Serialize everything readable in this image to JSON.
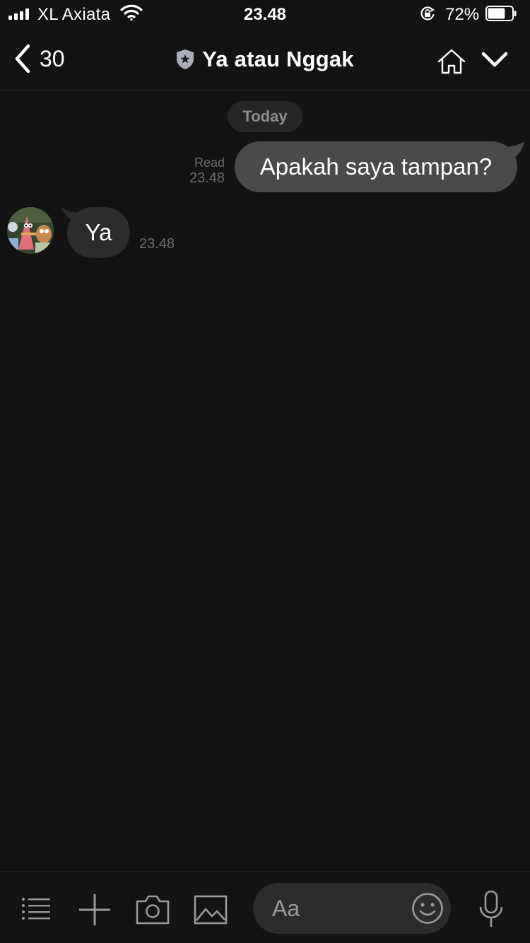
{
  "status_bar": {
    "carrier": "XL Axiata",
    "time": "23.48",
    "battery_percent": "72%",
    "battery_level": 0.72
  },
  "header": {
    "back_count": "30",
    "title": "Ya atau Nggak",
    "icons": [
      "chevron-left-icon",
      "shield-star-icon",
      "home-icon",
      "chevron-down-icon"
    ]
  },
  "chat": {
    "date_label": "Today",
    "messages": [
      {
        "direction": "sent",
        "text": "Apakah saya tampan?",
        "status": "Read",
        "time": "23.48"
      },
      {
        "direction": "received",
        "text": "Ya",
        "time": "23.48"
      }
    ]
  },
  "composer": {
    "placeholder": "Aa",
    "icons": [
      "menu-icon",
      "plus-icon",
      "camera-icon",
      "image-icon",
      "emoji-icon",
      "microphone-icon"
    ]
  },
  "colors": {
    "background": "#131313",
    "sent_bubble": "#4a4a4a",
    "received_bubble": "#2c2c2c",
    "muted_text": "#6c6c6c"
  }
}
